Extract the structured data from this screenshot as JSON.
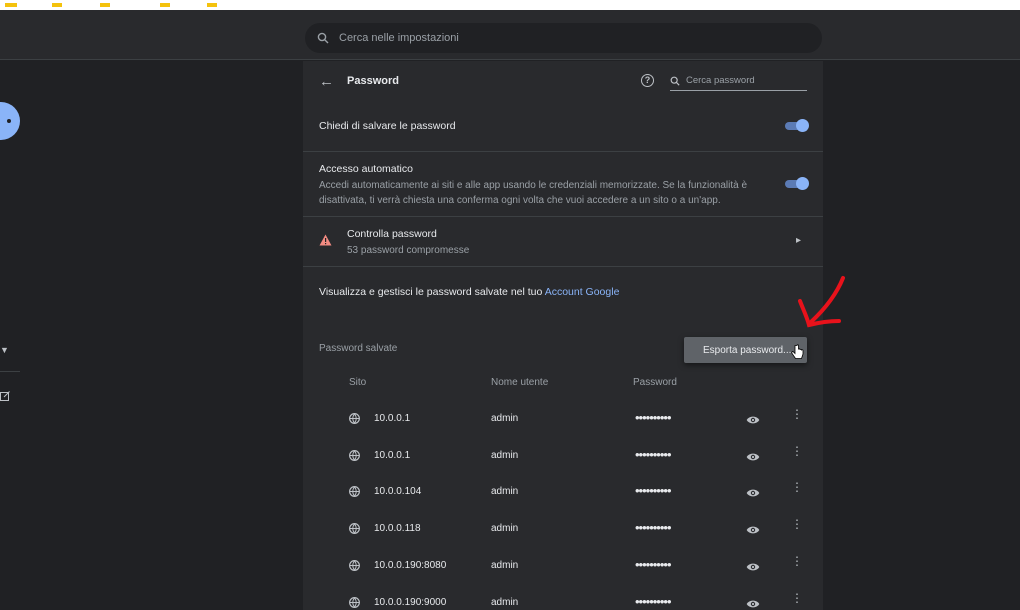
{
  "search": {
    "placeholder": "Cerca nelle impostazioni"
  },
  "passwords_page": {
    "title": "Password",
    "search_placeholder": "Cerca password"
  },
  "settings": {
    "offer_to_save": {
      "label": "Chiedi di salvare le password",
      "enabled": true
    },
    "auto_signin": {
      "label": "Accesso automatico",
      "description": "Accedi automaticamente ai siti e alle app usando le credenziali memorizzate. Se la funzionalità è disattivata, ti verrà chiesta una conferma ogni volta che vuoi accedere a un sito o a un'app.",
      "enabled": true
    },
    "check_passwords": {
      "label": "Controlla password",
      "sub": "53 password compromesse"
    },
    "google_account": {
      "prefix": "Visualizza e gestisci le password salvate nel tuo ",
      "link": "Account Google"
    }
  },
  "saved": {
    "label": "Password salvate",
    "export_menu_item": "Esporta password...",
    "columns": {
      "site": "Sito",
      "username": "Nome utente",
      "password": "Password"
    },
    "rows": [
      {
        "site": "10.0.0.1",
        "username": "admin",
        "password": "••••••••••"
      },
      {
        "site": "10.0.0.1",
        "username": "admin",
        "password": "••••••••••"
      },
      {
        "site": "10.0.0.104",
        "username": "admin",
        "password": "••••••••••"
      },
      {
        "site": "10.0.0.118",
        "username": "admin",
        "password": "••••••••••"
      },
      {
        "site": "10.0.0.190:8080",
        "username": "admin",
        "password": "••••••••••"
      },
      {
        "site": "10.0.0.190:9000",
        "username": "admin",
        "password": "••••••••••"
      }
    ]
  },
  "colors": {
    "accent": "#8ab4f8",
    "background": "#202124",
    "card": "#292a2d",
    "annotation": "#e8121b"
  }
}
